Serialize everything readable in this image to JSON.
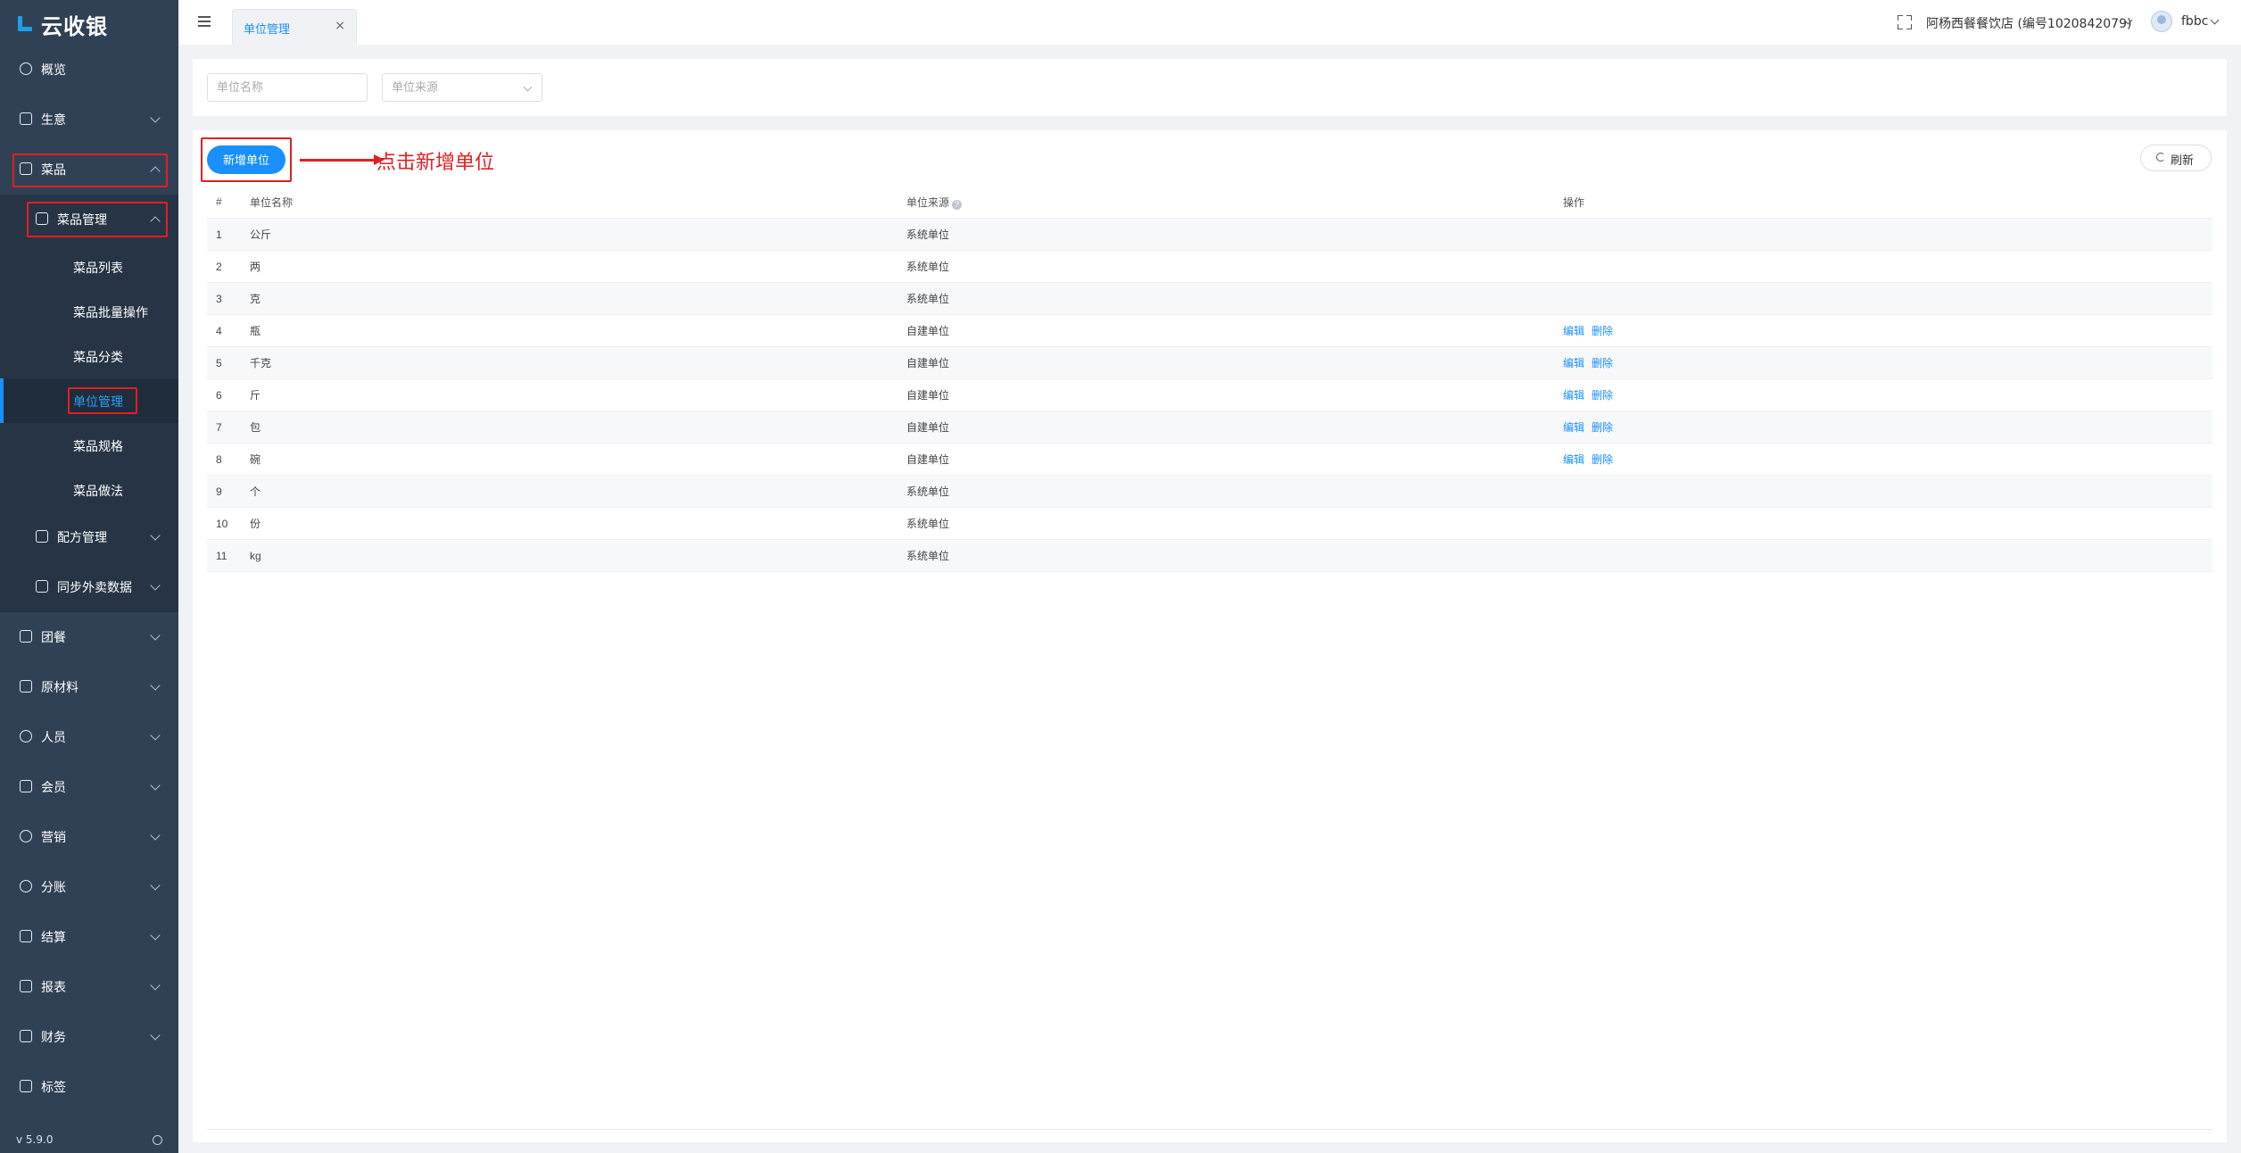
{
  "app": {
    "name": "云收银",
    "version": "v 5.9.0"
  },
  "sidebar": {
    "items": [
      {
        "label": "概览"
      },
      {
        "label": "生意"
      },
      {
        "label": "菜品"
      },
      {
        "label": "菜品管理"
      },
      {
        "label": "配方管理"
      },
      {
        "label": "同步外卖数据"
      },
      {
        "label": "团餐"
      },
      {
        "label": "原材料"
      },
      {
        "label": "人员"
      },
      {
        "label": "会员"
      },
      {
        "label": "营销"
      },
      {
        "label": "分账"
      },
      {
        "label": "结算"
      },
      {
        "label": "报表"
      },
      {
        "label": "财务"
      },
      {
        "label": "标签"
      }
    ],
    "subitems": [
      {
        "label": "菜品列表"
      },
      {
        "label": "菜品批量操作"
      },
      {
        "label": "菜品分类"
      },
      {
        "label": "单位管理"
      },
      {
        "label": "菜品规格"
      },
      {
        "label": "菜品做法"
      }
    ],
    "active_subitem": "单位管理"
  },
  "header": {
    "tab_label": "单位管理",
    "tab_close": "×",
    "store": "阿杨西餐餐饮店 (编号1020842079)",
    "user": "fbbc"
  },
  "filters": {
    "name_placeholder": "单位名称",
    "source_placeholder": "单位来源"
  },
  "toolbar": {
    "add_label": "新增单位",
    "annotation": "点击新增单位",
    "refresh_label": "刷新"
  },
  "table": {
    "columns": [
      "#",
      "单位名称",
      "单位来源",
      "操作"
    ],
    "rows": [
      {
        "idx": "1",
        "name": "公斤",
        "source": "系统单位",
        "ops": []
      },
      {
        "idx": "2",
        "name": "两",
        "source": "系统单位",
        "ops": []
      },
      {
        "idx": "3",
        "name": "克",
        "source": "系统单位",
        "ops": []
      },
      {
        "idx": "4",
        "name": "瓶",
        "source": "自建单位",
        "ops": [
          "编辑",
          "删除"
        ]
      },
      {
        "idx": "5",
        "name": "千克",
        "source": "自建单位",
        "ops": [
          "编辑",
          "删除"
        ]
      },
      {
        "idx": "6",
        "name": "斤",
        "source": "自建单位",
        "ops": [
          "编辑",
          "删除"
        ]
      },
      {
        "idx": "7",
        "name": "包",
        "source": "自建单位",
        "ops": [
          "编辑",
          "删除"
        ]
      },
      {
        "idx": "8",
        "name": "碗",
        "source": "自建单位",
        "ops": [
          "编辑",
          "删除"
        ]
      },
      {
        "idx": "9",
        "name": "个",
        "source": "系统单位",
        "ops": []
      },
      {
        "idx": "10",
        "name": "份",
        "source": "系统单位",
        "ops": []
      },
      {
        "idx": "11",
        "name": "kg",
        "source": "系统单位",
        "ops": []
      }
    ]
  },
  "colors": {
    "sidebar": "#304156",
    "primary": "#1890ff",
    "annotation": "#e02020"
  }
}
